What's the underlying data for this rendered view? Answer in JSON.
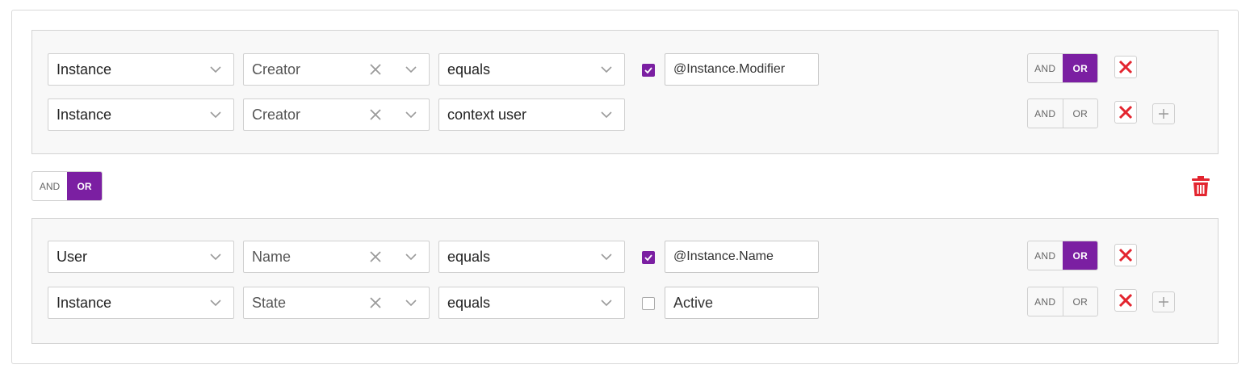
{
  "colors": {
    "accent": "#7b1fa2",
    "danger": "#e3252f"
  },
  "groups": [
    {
      "rows": [
        {
          "source": "Instance",
          "field": "Creator",
          "operator": "equals",
          "use_value": true,
          "value": "@Instance.Modifier",
          "logic_and": "AND",
          "logic_or": "OR",
          "active": "OR"
        },
        {
          "source": "Instance",
          "field": "Creator",
          "operator": "context user",
          "logic_and": "AND",
          "logic_or": "OR",
          "active": "none"
        }
      ]
    },
    {
      "rows": [
        {
          "source": "User",
          "field": "Name",
          "operator": "equals",
          "use_value": true,
          "value": "@Instance.Name",
          "logic_and": "AND",
          "logic_or": "OR",
          "active": "OR"
        },
        {
          "source": "Instance",
          "field": "State",
          "operator": "equals",
          "use_value": false,
          "value": "Active",
          "logic_and": "AND",
          "logic_or": "OR",
          "active": "none"
        }
      ]
    }
  ],
  "group_logic": {
    "and_label": "AND",
    "or_label": "OR",
    "active": "OR"
  },
  "icons": {
    "delete_group": "trash-icon",
    "remove_row": "close-icon",
    "add_row": "plus-icon",
    "dropdown": "chevron-down-icon",
    "clear": "clear-icon",
    "checkbox": "check-icon"
  }
}
